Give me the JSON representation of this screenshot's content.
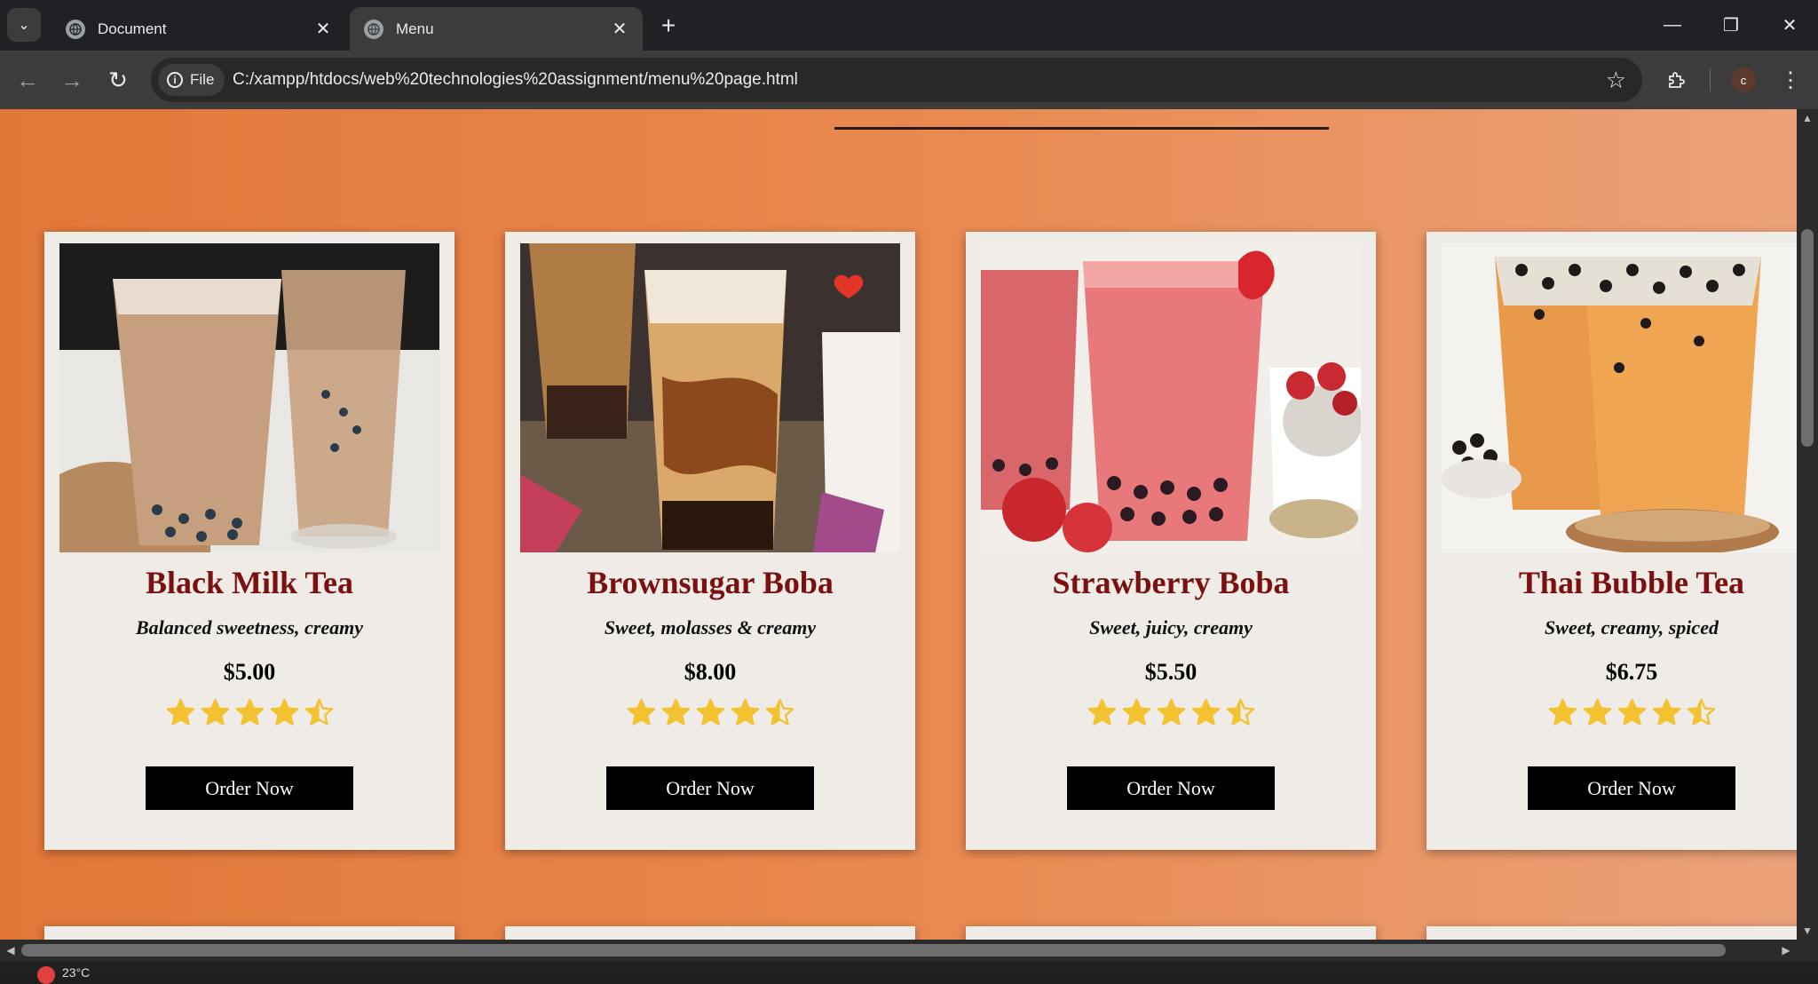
{
  "browser": {
    "tabs": [
      {
        "title": "Document",
        "active": false
      },
      {
        "title": "Menu",
        "active": true
      }
    ],
    "site_info_label": "File",
    "url": "C:/xampp/htdocs/web%20technologies%20assignment/menu%20page.html",
    "profile_initial": "c"
  },
  "menu": {
    "items": [
      {
        "name": "Black Milk Tea",
        "description": "Balanced sweetness, creamy",
        "price": "$5.00",
        "rating": 4.5,
        "button": "Order Now"
      },
      {
        "name": "Brownsugar Boba",
        "description": "Sweet, molasses & creamy",
        "price": "$8.00",
        "rating": 4.5,
        "button": "Order Now"
      },
      {
        "name": "Strawberry Boba",
        "description": "Sweet, juicy, creamy",
        "price": "$5.50",
        "rating": 4.5,
        "button": "Order Now"
      },
      {
        "name": "Thai Bubble Tea",
        "description": "Sweet, creamy, spiced",
        "price": "$6.75",
        "rating": 4.5,
        "button": "Order Now"
      }
    ]
  },
  "taskbar": {
    "weather": "23°C"
  },
  "colors": {
    "accent": "#e27738",
    "title": "#7a1010",
    "star": "#f2c230",
    "button": "#000000",
    "card": "#efebe6"
  }
}
